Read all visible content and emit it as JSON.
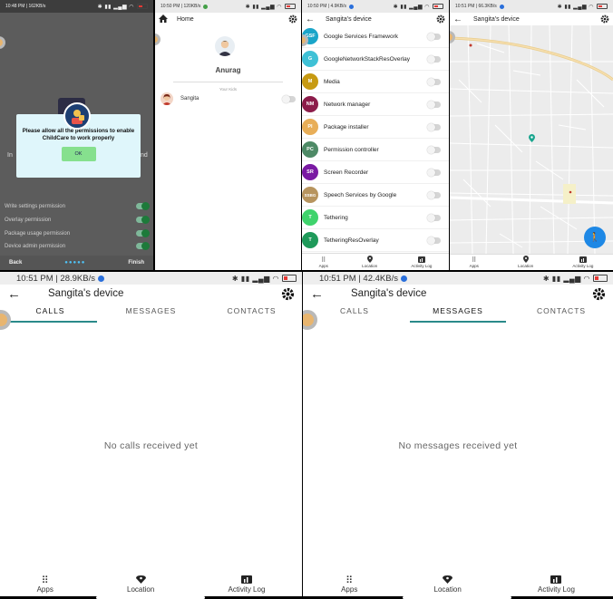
{
  "panel1": {
    "status_time": "10:48 PM | 162KB/s",
    "dialog_message": "Please allow all the permissions to enable ChildCare to work properly",
    "ok_label": "OK",
    "background_fragments": [
      "In",
      "nd"
    ],
    "permissions": [
      {
        "label": "Write settings permission",
        "enabled": true
      },
      {
        "label": "Overlay permission",
        "enabled": true
      },
      {
        "label": "Package usage permission",
        "enabled": true
      },
      {
        "label": "Device admin permission",
        "enabled": true
      }
    ],
    "back_label": "Back",
    "finish_label": "Finish",
    "colors": {
      "toggle_on": "#1d7a3a",
      "dialog_bg": "#dff6fb",
      "ok_bg": "#86e08e"
    }
  },
  "panel2": {
    "status_time": "10:50 PM | 120KB/s",
    "title": "Home",
    "parent_name": "Anurag",
    "kids_label": "Your Kids",
    "kids": [
      {
        "name": "Sangita",
        "enabled": false
      }
    ]
  },
  "panel3": {
    "status_time": "10:50 PM | 4.9KB/s",
    "title": "Sangita's device",
    "apps": [
      {
        "initials": "GSF",
        "name": "Google Services Framework",
        "color": "#1aa5c9"
      },
      {
        "initials": "G",
        "name": "GoogleNetworkStackResOverlay",
        "color": "#3fc1d6"
      },
      {
        "initials": "M",
        "name": "Media",
        "color": "#c79a12"
      },
      {
        "initials": "NM",
        "name": "Network manager",
        "color": "#8c1c4a"
      },
      {
        "initials": "PI",
        "name": "Package installer",
        "color": "#e8ae58"
      },
      {
        "initials": "PC",
        "name": "Permission controller",
        "color": "#4e8a66"
      },
      {
        "initials": "SR",
        "name": "Screen Recorder",
        "color": "#7a1aa3"
      },
      {
        "initials": "SSBG",
        "name": "Speech Services by Google",
        "color": "#b7945e"
      },
      {
        "initials": "T",
        "name": "Tethering",
        "color": "#3fd36c"
      },
      {
        "initials": "T",
        "name": "TetheringResOverlay",
        "color": "#1f9a5a"
      }
    ],
    "nav": [
      "Apps",
      "Location",
      "Activity Log"
    ]
  },
  "panel4": {
    "status_time": "10:51 PM | 66.3KB/s",
    "title": "Sangita's device",
    "nav": [
      "Apps",
      "Location",
      "Activity Log"
    ]
  },
  "panel5": {
    "status_time": "10:51 PM | 28.9KB/s",
    "title": "Sangita's device",
    "tabs": [
      "CALLS",
      "MESSAGES",
      "CONTACTS"
    ],
    "active_tab": "CALLS",
    "empty_message": "No calls received yet",
    "nav": [
      "Apps",
      "Location",
      "Activity Log"
    ]
  },
  "panel6": {
    "status_time": "10:51 PM | 42.4KB/s",
    "title": "Sangita's device",
    "tabs": [
      "CALLS",
      "MESSAGES",
      "CONTACTS"
    ],
    "active_tab": "MESSAGES",
    "empty_message": "No messages received yet",
    "nav": [
      "Apps",
      "Location",
      "Activity Log"
    ]
  },
  "colors": {
    "accent": "#2a8a8a",
    "map_fab": "#1e88e5"
  }
}
